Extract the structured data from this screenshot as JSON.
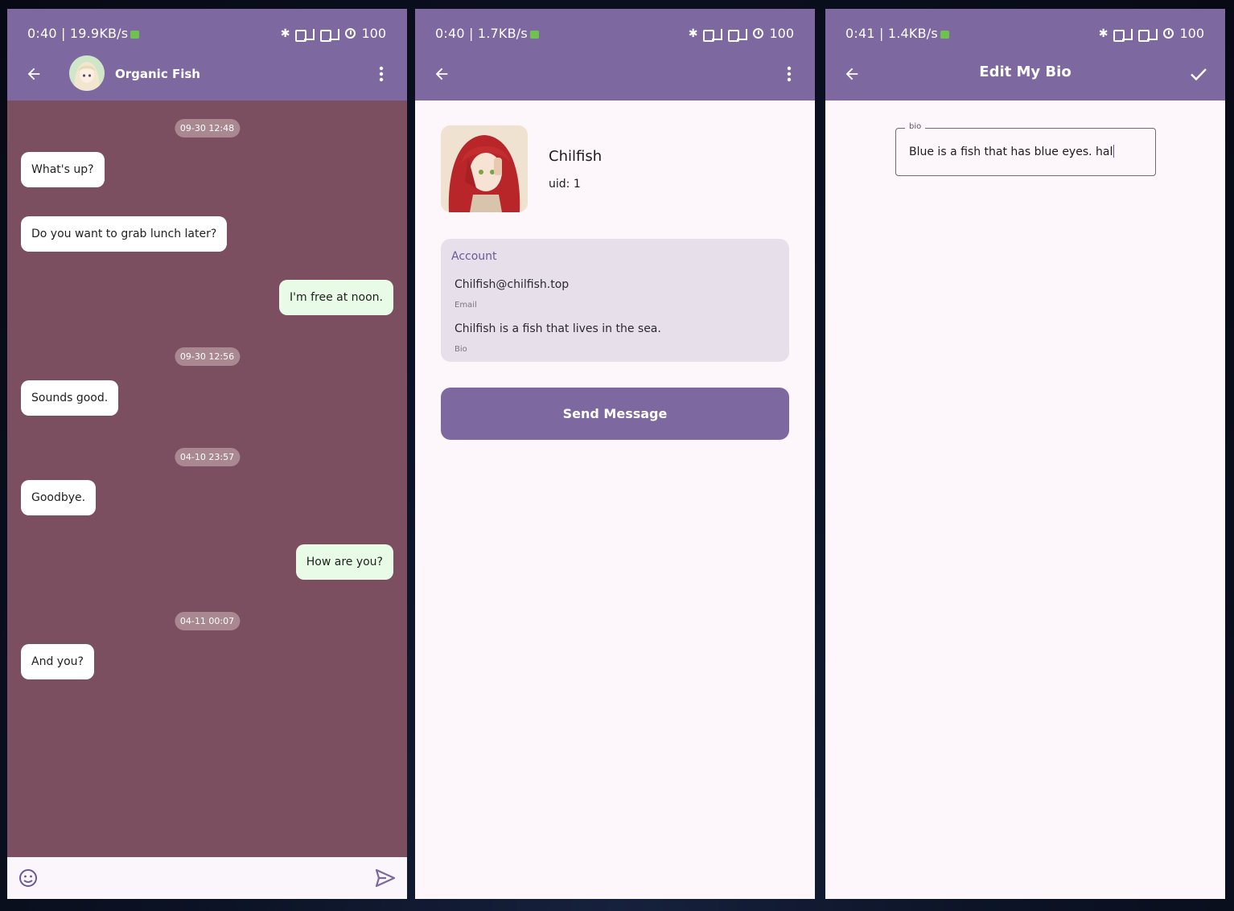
{
  "screens": {
    "chat": {
      "status": {
        "time": "0:40 | 19.9KB/s",
        "battery": "100"
      },
      "title": "Organic Fish",
      "messages": [
        {
          "type": "timestamp",
          "text": "09-30 12:48"
        },
        {
          "type": "incoming",
          "text": "What's up?"
        },
        {
          "type": "incoming",
          "text": "Do you want to grab lunch later?"
        },
        {
          "type": "outgoing",
          "text": "I'm free at noon."
        },
        {
          "type": "timestamp",
          "text": "09-30 12:56"
        },
        {
          "type": "incoming",
          "text": "Sounds good."
        },
        {
          "type": "timestamp",
          "text": "04-10 23:57"
        },
        {
          "type": "incoming",
          "text": "Goodbye."
        },
        {
          "type": "outgoing",
          "text": "How are you?"
        },
        {
          "type": "timestamp",
          "text": "04-11 00:07"
        },
        {
          "type": "incoming",
          "text": "And you?"
        }
      ],
      "input": {
        "value": ""
      }
    },
    "profile": {
      "status": {
        "time": "0:40 | 1.7KB/s",
        "battery": "100"
      },
      "name": "Chilfish",
      "uid": "uid: 1",
      "account": {
        "title": "Account",
        "email": "Chilfish@chilfish.top",
        "email_label": "Email",
        "bio": "Chilfish is a fish that lives in the sea.",
        "bio_label": "Bio"
      },
      "send_button": "Send Message"
    },
    "edit_bio": {
      "status": {
        "time": "0:41 | 1.4KB/s",
        "battery": "100"
      },
      "title": "Edit My Bio",
      "field_label": "bio",
      "field_value": "Blue is a fish that has blue eyes.  hal"
    }
  },
  "colors": {
    "app_bar": "#7e68a0",
    "chat_background": "#7b4f60",
    "outgoing_bubble": "#e8fbe6",
    "incoming_bubble": "#ffffff",
    "surface": "#fdf7fb",
    "card": "#e7e0eb",
    "accent_text": "#6a5996"
  }
}
